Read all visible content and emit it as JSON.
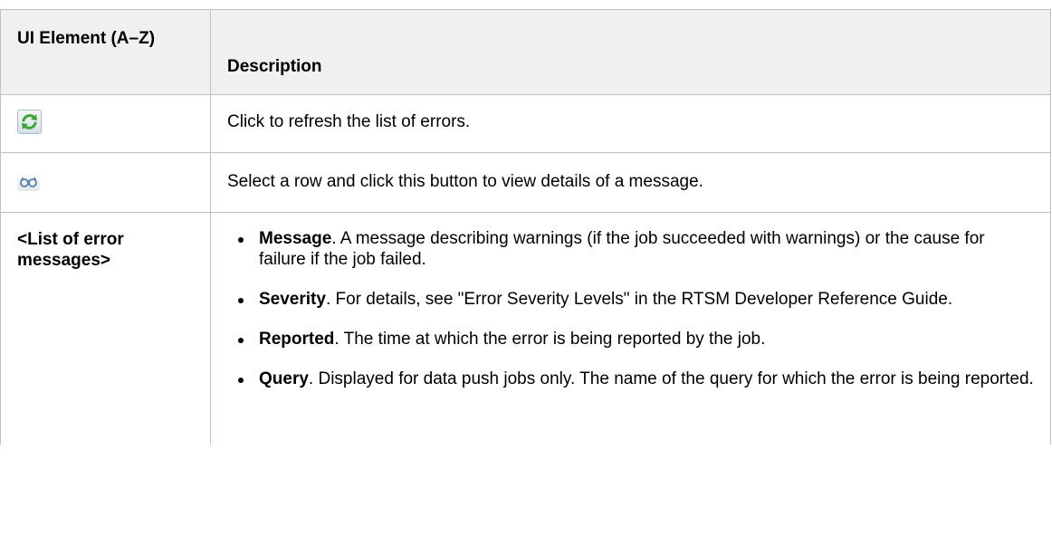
{
  "table": {
    "header": {
      "element": "UI Element (A–Z)",
      "description": "Description"
    },
    "rows": [
      {
        "icon": "refresh-icon",
        "description": "Click to refresh the list of errors."
      },
      {
        "icon": "view-details-icon",
        "description": "Select a row and click this button to view details of a message."
      },
      {
        "element": "<List of error messages>",
        "items": [
          {
            "term": "Message",
            "text": ". A message describing warnings (if the job succeeded with warnings) or the cause for failure if the job failed."
          },
          {
            "term": "Severity",
            "text": ". For details, see \"Error Severity Levels\" in the RTSM Developer Reference Guide."
          },
          {
            "term": "Reported",
            "text": ". The time at which the error is being reported by the job."
          },
          {
            "term": "Query",
            "text": ". Displayed for data push jobs only. The name of the query for which the error is being reported."
          }
        ]
      }
    ]
  },
  "colors": {
    "header_bg": "#f0f0f0",
    "border": "#c0c0c0",
    "refresh_arrow": "#3fa535"
  }
}
